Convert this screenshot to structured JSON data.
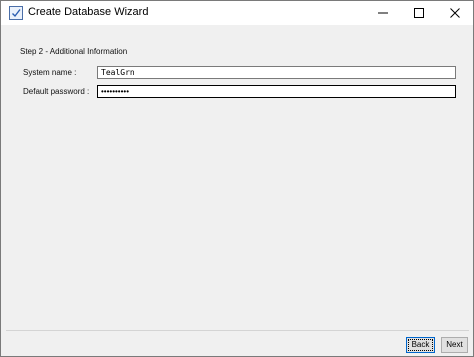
{
  "window": {
    "title": "Create Database Wizard",
    "icon": "wizard-check-icon",
    "controls": [
      "minimize-icon",
      "maximize-icon",
      "close-icon"
    ]
  },
  "wizard": {
    "step_title": "Step 2 - Additional Information",
    "fields": {
      "system_name_label": "System name :",
      "system_name_value": "TealGrn",
      "default_password_label": "Default password :",
      "default_password_value": "••••••••••"
    }
  },
  "footer": {
    "back_label": "Back",
    "next_label": "Next"
  }
}
